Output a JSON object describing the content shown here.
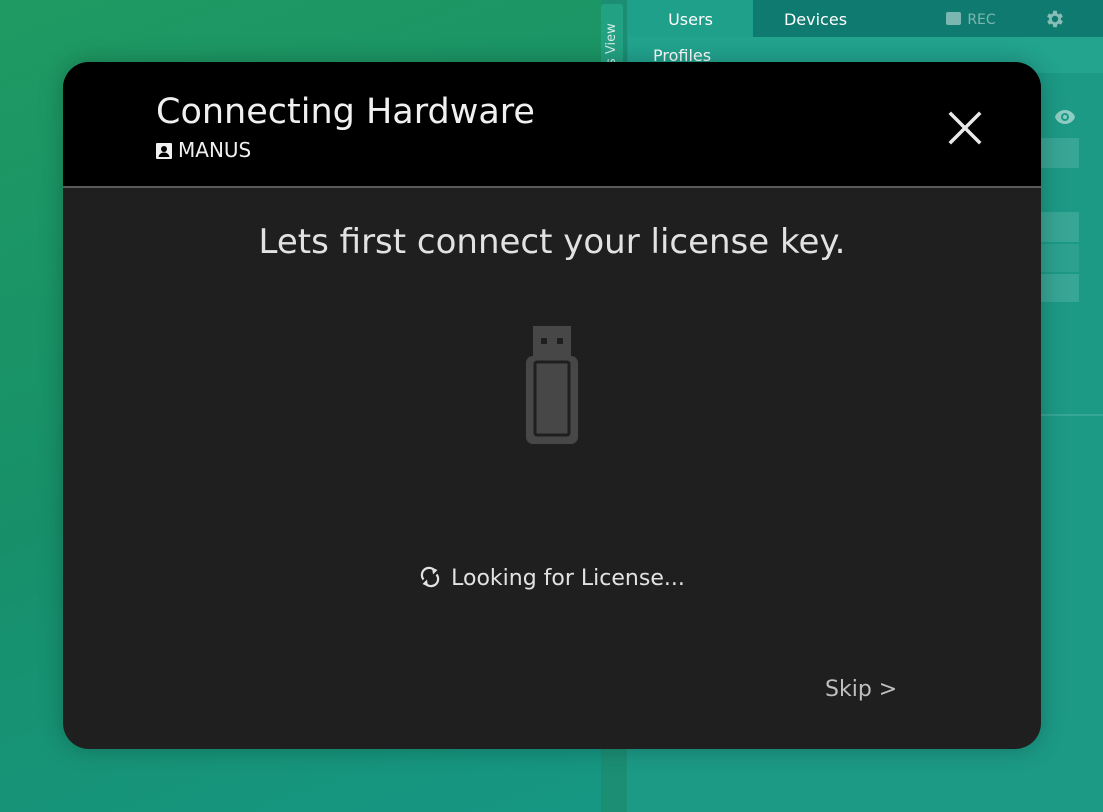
{
  "background": {
    "side_tab_label": "s View",
    "tabs": [
      {
        "label": "Users"
      },
      {
        "label": "Devices"
      }
    ],
    "rec_label": "REC",
    "subheader": "Profiles"
  },
  "modal": {
    "title": "Connecting Hardware",
    "subtitle": "MANUS",
    "heading": "Lets first connect your license key.",
    "status": "Looking for License...",
    "skip_label": "Skip >"
  },
  "icons": {
    "close": "close-icon",
    "profile": "contact-card-icon",
    "usb": "usb-key-icon",
    "sync": "sync-icon",
    "settings": "gear-icon",
    "record": "clapperboard-icon",
    "visibility": "eye-icon"
  },
  "colors": {
    "modal_background": "#1f1f1f",
    "modal_header": "#000000",
    "text_primary": "#f0f0f0",
    "app_accent": "#1c9a86"
  }
}
